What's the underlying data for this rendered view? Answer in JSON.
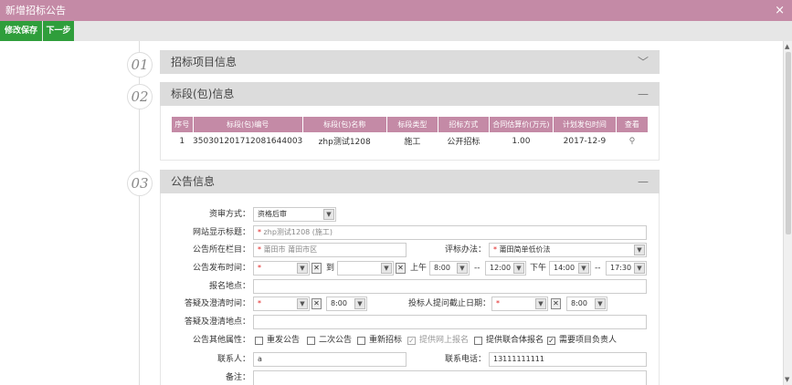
{
  "window": {
    "title": "新增招标公告",
    "close_glyph": "×"
  },
  "toolbar": {
    "save_label": "修改保存",
    "next_label": "下一步"
  },
  "sections": {
    "s1": {
      "num": "01",
      "title": "招标项目信息",
      "toggle": "﹀"
    },
    "s2": {
      "num": "02",
      "title": "标段(包)信息",
      "toggle": "—"
    },
    "s3": {
      "num": "03",
      "title": "公告信息",
      "toggle": "—"
    }
  },
  "bid_table": {
    "headers": [
      "序号",
      "标段(包)编号",
      "标段(包)名称",
      "标段类型",
      "招标方式",
      "合同估算价(万元)",
      "计划发包时间",
      "查看"
    ],
    "rows": [
      [
        "1",
        "350301201712081644003",
        "zhp测试1208",
        "施工",
        "公开招标",
        "1.00",
        "2017-12-9"
      ]
    ]
  },
  "form": {
    "review_mode": {
      "label": "资审方式：",
      "value": "资格后审"
    },
    "site_title": {
      "label": "网站显示标题：",
      "value": "zhp测试1208 (施工)"
    },
    "column": {
      "label": "公告所在栏目：",
      "value": "莆田市 莆田市区"
    },
    "eval_method": {
      "label": "评标办法：",
      "value": "莆田简单低价法"
    },
    "publish_time": {
      "label": "公告发布时间：",
      "to": "到",
      "dash": "--",
      "am_label": "上午",
      "pm_label": "下午",
      "am_start": "8:00",
      "am_end": "12:00",
      "pm_start": "14:00",
      "pm_end": "17:30"
    },
    "signup_place": {
      "label": "报名地点："
    },
    "clarify_time": {
      "label": "答疑及澄清时间：",
      "time": "8:00"
    },
    "deadline": {
      "label": "投标人提问截止日期：",
      "time": "8:00"
    },
    "clarify_place": {
      "label": "答疑及澄清地点："
    },
    "other_attrs": {
      "label": "公告其他属性：",
      "options": [
        {
          "label": "重发公告",
          "checked": false,
          "disabled": false
        },
        {
          "label": "二次公告",
          "checked": false,
          "disabled": false
        },
        {
          "label": "重新招标",
          "checked": false,
          "disabled": false
        },
        {
          "label": "提供网上报名",
          "checked": true,
          "disabled": true
        },
        {
          "label": "提供联合体报名",
          "checked": false,
          "disabled": false
        },
        {
          "label": "需要项目负责人",
          "checked": true,
          "disabled": false
        }
      ]
    },
    "contact": {
      "label": "联系人：",
      "value": "a"
    },
    "phone": {
      "label": "联系电话：",
      "value": "13111111111"
    },
    "remark": {
      "label": "备注："
    }
  },
  "glyphs": {
    "arrow": "▼",
    "x": "✕",
    "check": "✓",
    "search": "⚲",
    "required": "*",
    "scroll_up": "▲",
    "scroll_down": "▼"
  }
}
